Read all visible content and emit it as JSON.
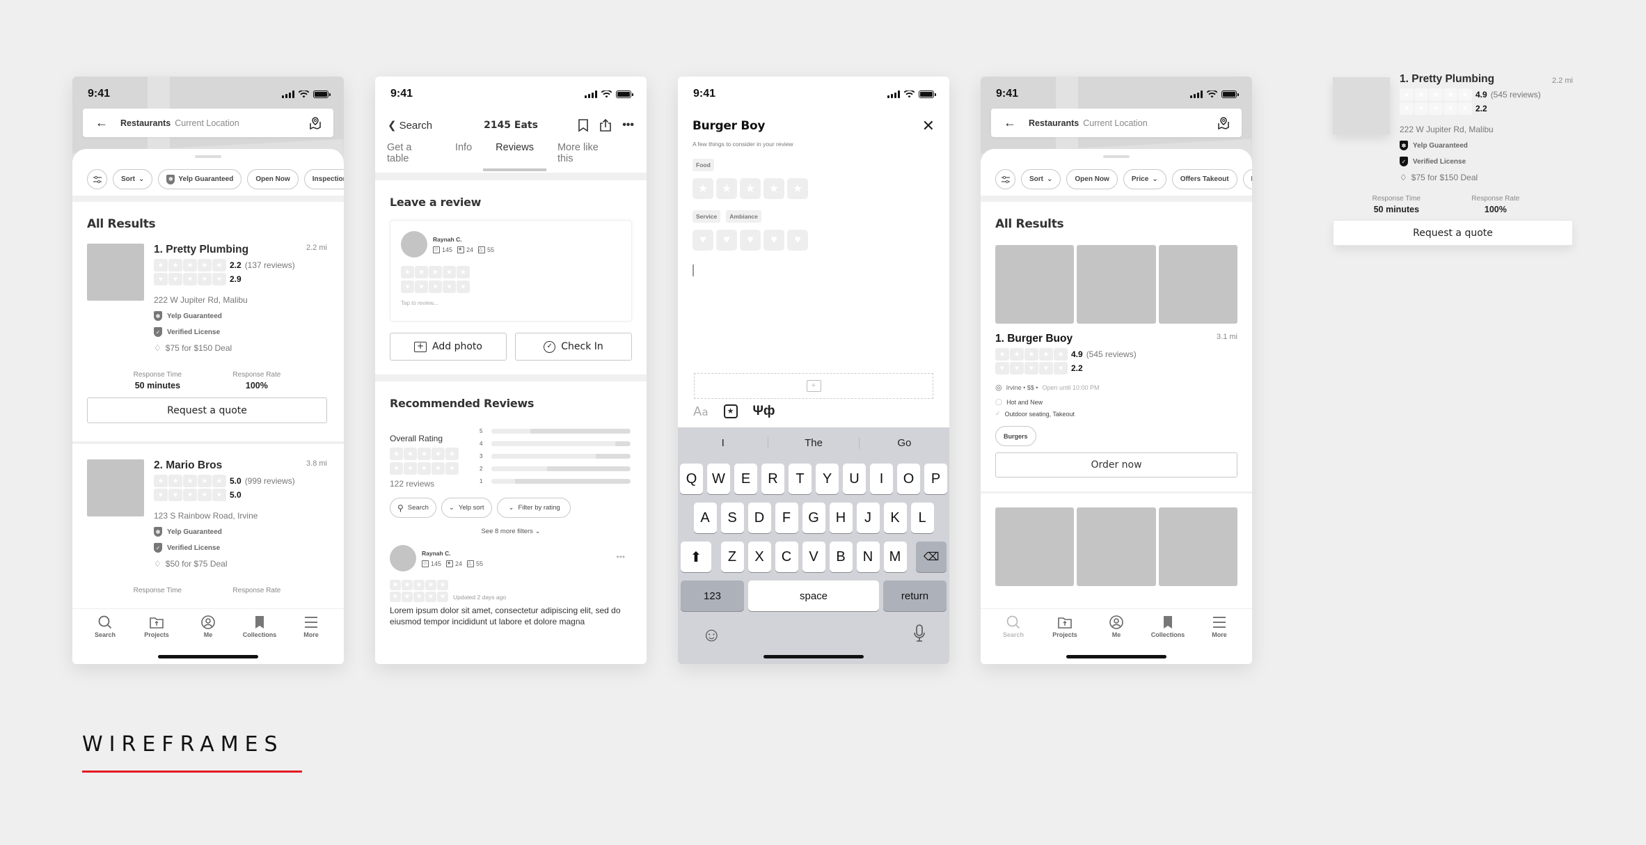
{
  "status_bar": {
    "time": "9:41"
  },
  "accent_color": "#e31b23",
  "search_screen_1": {
    "search": {
      "query": "Restaurants",
      "location": "Current Location"
    },
    "filters": [
      "Sort",
      "Yelp Guaranteed",
      "Open Now",
      "Inspection"
    ],
    "section_title": "All Results",
    "results": [
      {
        "name": "1. Pretty Plumbing",
        "distance": "2.2 mi",
        "rating": "2.2",
        "reviews": "(137 reviews)",
        "secondary_rating": "2.9",
        "address": "222 W Jupiter Rd, Malibu",
        "badge1": "Yelp Guaranteed",
        "badge2": "Verified License",
        "deal": "$75 for $150 Deal",
        "response_time_label": "Response Time",
        "response_time": "50 minutes",
        "response_rate_label": "Response Rate",
        "response_rate": "100%",
        "cta": "Request a quote"
      },
      {
        "name": "2. Mario Bros",
        "distance": "3.8 mi",
        "rating": "5.0",
        "reviews": "(999 reviews)",
        "secondary_rating": "5.0",
        "address": "123 S Rainbow Road, Irvine",
        "badge1": "Yelp Guaranteed",
        "badge2": "Verified License",
        "deal": "$50 for $75 Deal",
        "response_time_label": "Response Time",
        "response_rate_label": "Response Rate"
      }
    ]
  },
  "tabbar": {
    "items": [
      "Search",
      "Projects",
      "Me",
      "Collections",
      "More"
    ]
  },
  "business_screen": {
    "back_label": "Search",
    "title": "2145 Eats",
    "tabs": [
      "Get a table",
      "Info",
      "Reviews",
      "More like this"
    ],
    "active_tab": "Reviews",
    "leave_review_title": "Leave a review",
    "reviewer": {
      "name": "Raynah C.",
      "friends": "145",
      "reviews": "24",
      "photos": "55"
    },
    "tap_placeholder": "Tap to review...",
    "add_photo": "Add photo",
    "check_in": "Check In",
    "recommended_title": "Recommended Reviews",
    "overall_label": "Overall Rating",
    "review_count": "122 reviews",
    "distribution": [
      {
        "star": "5",
        "fraction": 0.28
      },
      {
        "star": "4",
        "fraction": 0.89
      },
      {
        "star": "3",
        "fraction": 0.75
      },
      {
        "star": "2",
        "fraction": 0.4
      },
      {
        "star": "1",
        "fraction": 0.17
      }
    ],
    "review_filters": [
      "Search",
      "Yelp sort",
      "Filter by rating"
    ],
    "more_filters": "See 8 more filters",
    "review": {
      "name": "Raynah C.",
      "friends": "145",
      "reviews": "24",
      "photos": "55",
      "updated": "Updated 2 days ago",
      "text": "Lorem ipsum dolor sit amet, consectetur adipiscing elit, sed do eiusmod tempor incididunt ut labore et dolore magna"
    }
  },
  "write_review_screen": {
    "title": "Burger Boy",
    "subtitle": "A few things to consider in your review",
    "tag_food": "Food",
    "tag_service": "Service",
    "tag_ambiance": "Ambiance",
    "text_value": "",
    "suggestions": [
      "I",
      "The",
      "Go"
    ],
    "keyboard_rows": [
      [
        "Q",
        "W",
        "E",
        "R",
        "T",
        "Y",
        "U",
        "I",
        "O",
        "P"
      ],
      [
        "A",
        "S",
        "D",
        "F",
        "G",
        "H",
        "J",
        "K",
        "L"
      ],
      [
        "Z",
        "X",
        "C",
        "V",
        "B",
        "N",
        "M"
      ]
    ],
    "key_123": "123",
    "key_space": "space",
    "key_return": "return"
  },
  "search_screen_2": {
    "search": {
      "query": "Restaurants",
      "location": "Current Location"
    },
    "filters": [
      "Sort",
      "Open Now",
      "Price",
      "Offers Takeout",
      "D"
    ],
    "section_title": "All Results",
    "result": {
      "name": "1. Burger Buoy",
      "distance": "3.1 mi",
      "rating": "4.9",
      "reviews": "(545 reviews)",
      "secondary_rating": "2.2",
      "location": "Irvine • $$ •",
      "hours": "Open until 10:00 PM",
      "highlight": "Hot and New",
      "amenities": "Outdoor seating, Takeout",
      "category": "Burgers",
      "cta": "Order now"
    }
  },
  "floating_card": {
    "name": "1. Pretty Plumbing",
    "distance": "2.2 mi",
    "rating": "4.9",
    "reviews": "(545 reviews)",
    "secondary_rating": "2.2",
    "address": "222 W Jupiter Rd, Malibu",
    "badge1": "Yelp Guaranteed",
    "badge2": "Verified License",
    "deal": "$75 for $150 Deal",
    "response_time_label": "Response Time",
    "response_time": "50 minutes",
    "response_rate_label": "Response Rate",
    "response_rate": "100%",
    "cta": "Request a quote"
  },
  "page_title": "WIREFRAMES"
}
